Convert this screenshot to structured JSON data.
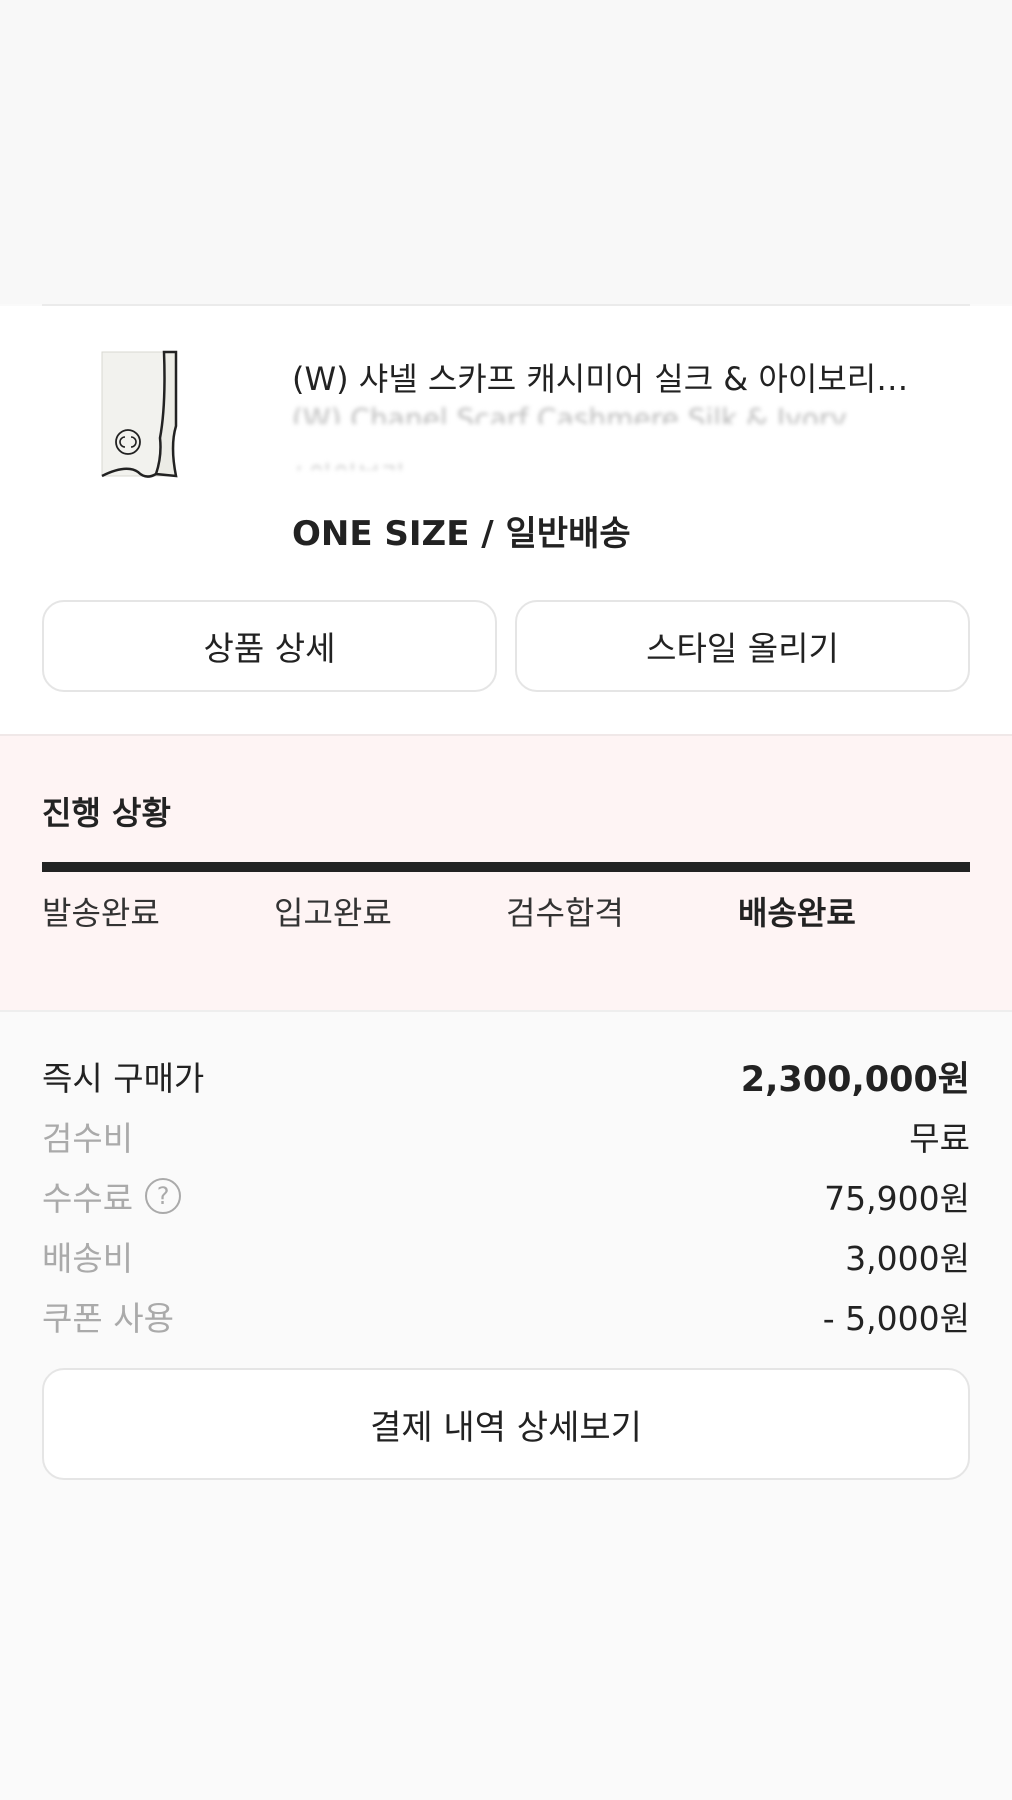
{
  "product": {
    "title": "(W) 샤넬 스카프 캐시미어 실크 & 아이보리…",
    "subtitle": "(W) Chanel Scarf Cashmere Silk & Ivory",
    "subtitle2": "/ 아이보리",
    "option": "ONE SIZE / 일반배송",
    "detail_button": "상품 상세",
    "style_button": "스타일 올리기"
  },
  "progress": {
    "title": "진행 상황",
    "steps": [
      "발송완료",
      "입고완료",
      "검수합격",
      "배송완료"
    ]
  },
  "price": {
    "rows": [
      {
        "label": "즉시 구매가",
        "value": "2,300,000원"
      },
      {
        "label": "검수비",
        "value": "무료"
      },
      {
        "label": "수수료",
        "value": "75,900원"
      },
      {
        "label": "배송비",
        "value": "3,000원"
      },
      {
        "label": "쿠폰 사용",
        "value": "- 5,000원"
      }
    ],
    "help_glyph": "?",
    "payment_detail_button": "결제 내역 상세보기"
  },
  "colors": {
    "progress_bg": "#fef4f4",
    "progress_bar": "#222222",
    "muted_label": "#aaaaaa"
  }
}
